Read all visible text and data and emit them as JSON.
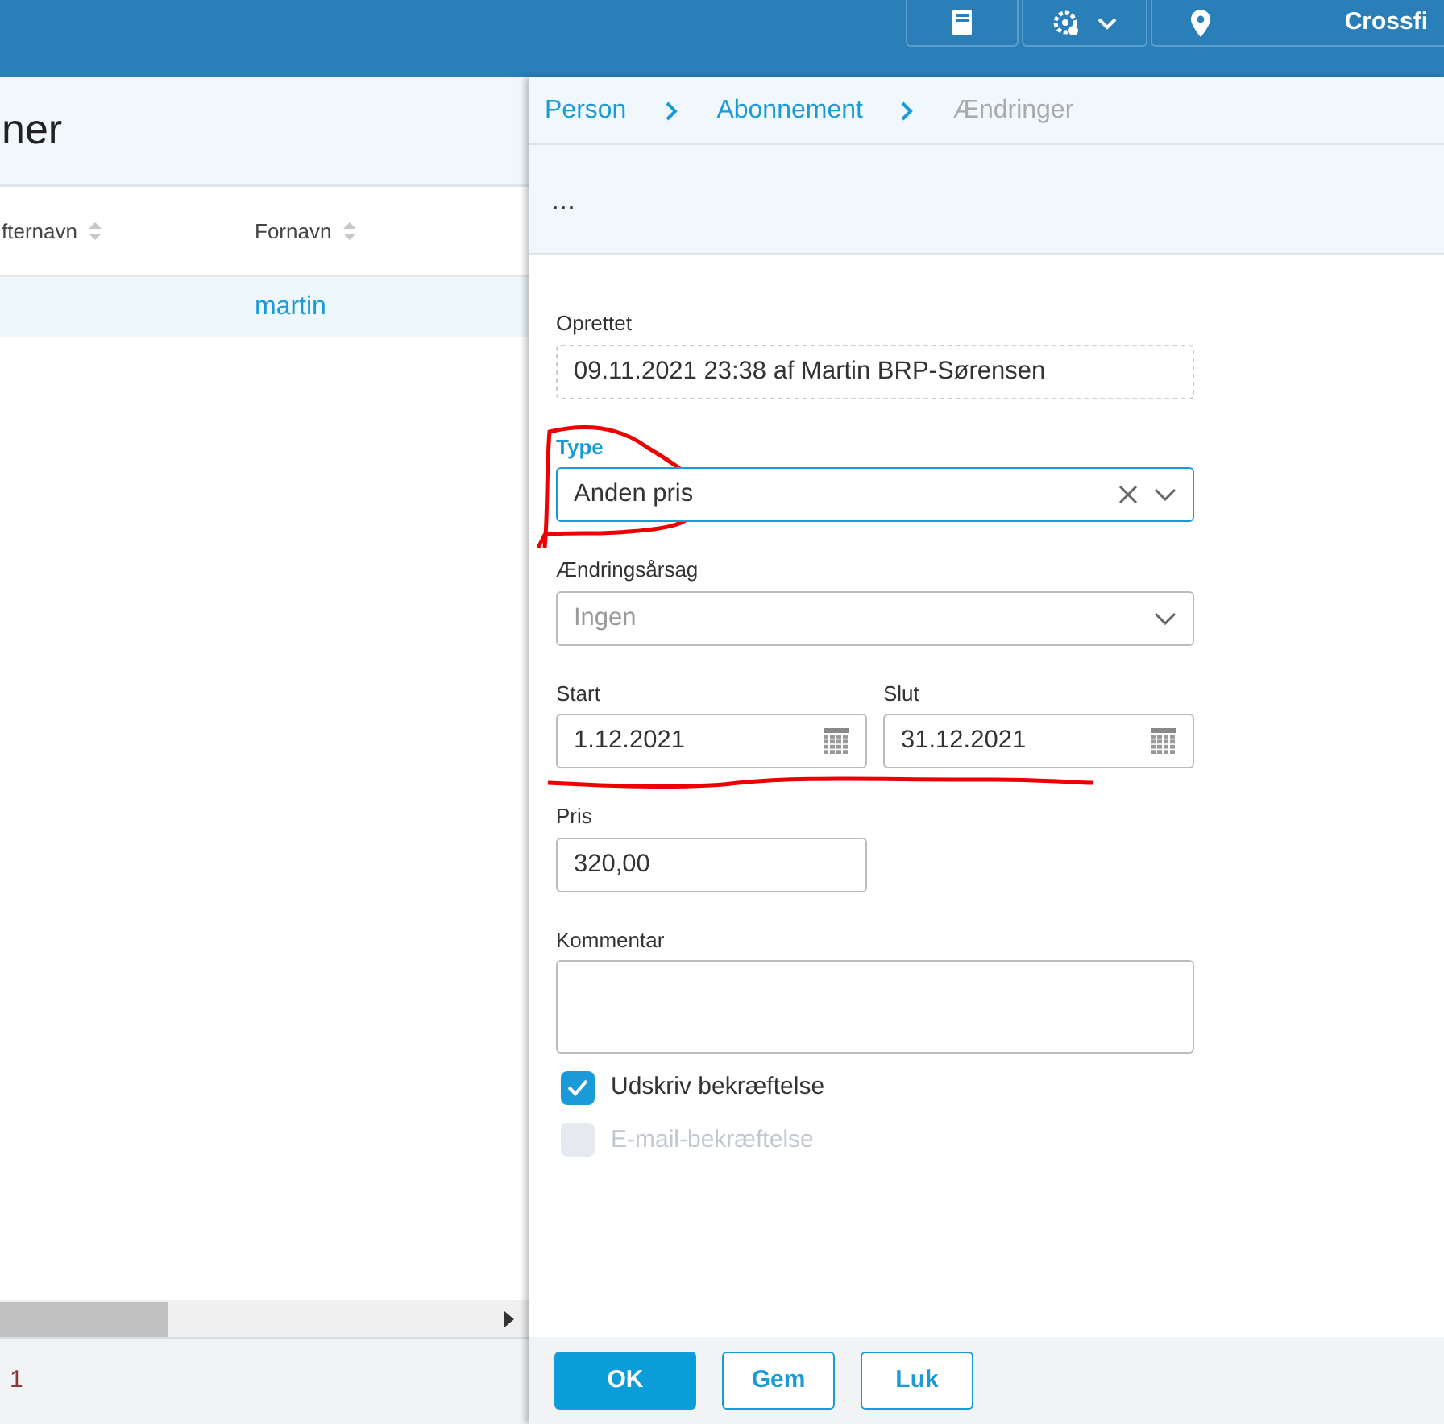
{
  "top_bar": {
    "tools": [
      {
        "kind": "notebook"
      },
      {
        "kind": "settings"
      }
    ],
    "location": "Crossfi"
  },
  "list_panel": {
    "title": "ner",
    "columns": [
      {
        "label": "fternavn"
      },
      {
        "label": "Fornavn"
      }
    ],
    "rows": [
      {
        "fornavn": "martin"
      }
    ],
    "pager": "1"
  },
  "detail_panel": {
    "breadcrumb": [
      {
        "label": "Person",
        "current": false
      },
      {
        "label": "Abonnement",
        "current": false
      },
      {
        "label": "Ændringer",
        "current": true
      }
    ],
    "toolbar": "...",
    "form": {
      "created": {
        "label": "Oprettet",
        "value": "09.11.2021 23:38 af Martin BRP-Sørensen"
      },
      "type": {
        "label": "Type",
        "value": "Anden pris",
        "focused": true
      },
      "reason": {
        "label": "Ændringsårsag",
        "placeholder": "Ingen",
        "focused": false
      },
      "start": {
        "label": "Start",
        "value": "1.12.2021"
      },
      "end": {
        "label": "Slut",
        "value": "31.12.2021"
      },
      "price": {
        "label": "Pris",
        "value": "320,00"
      },
      "comment": {
        "label": "Kommentar"
      },
      "checkboxes": [
        {
          "label": "Udskriv bekræftelse",
          "checked": true,
          "disabled": false
        },
        {
          "label": "E-mail-bekræftelse",
          "checked": false,
          "disabled": true
        }
      ]
    },
    "buttons": [
      {
        "label": "OK",
        "kind": "primary"
      },
      {
        "label": "Gem",
        "kind": "outline"
      },
      {
        "label": "Luk",
        "kind": "outline"
      }
    ]
  }
}
